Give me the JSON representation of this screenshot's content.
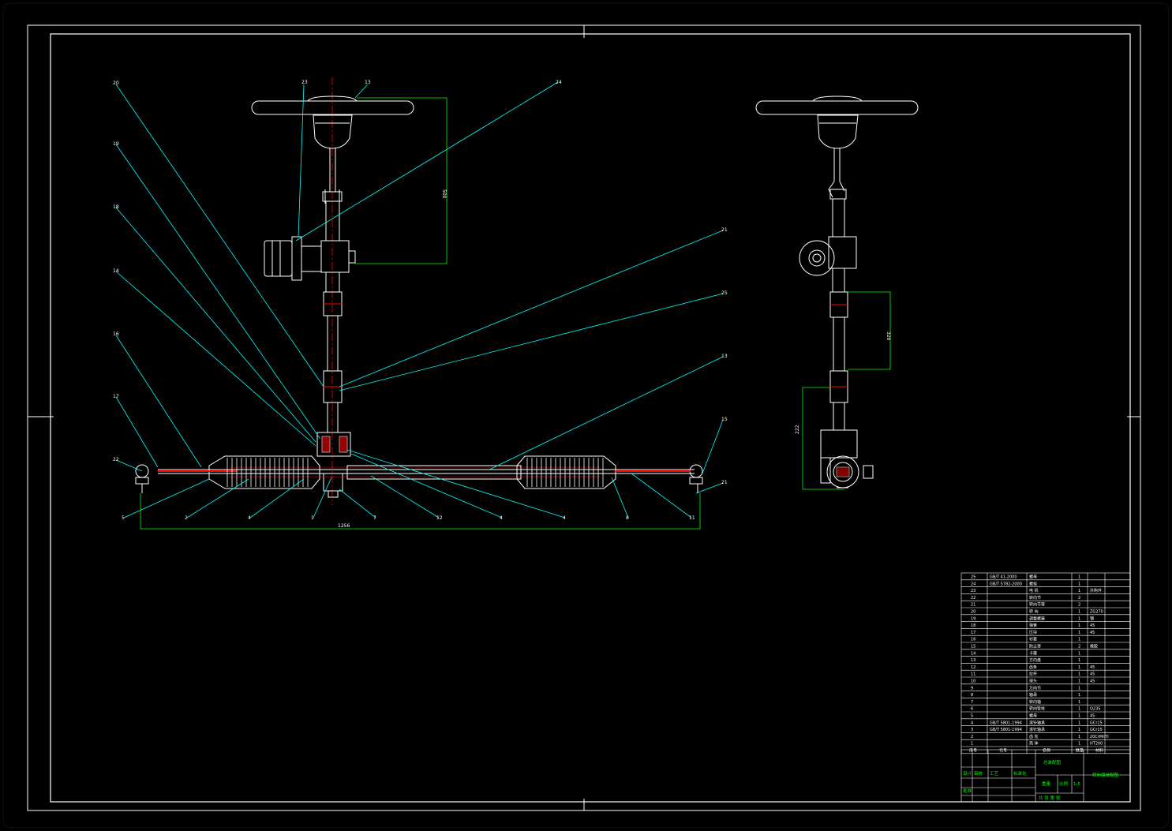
{
  "drawing": {
    "colors": {
      "background": "#000000",
      "outline": "#ffffff",
      "leader": "#00ffff",
      "dimension": "#00ff00",
      "centerline": "#ff0000",
      "section_fill": "#ff0000"
    },
    "callouts_top": [
      "23",
      "13",
      "24"
    ],
    "callouts_left": [
      "20",
      "19",
      "18",
      "14",
      "16",
      "17",
      "22"
    ],
    "callouts_right": [
      "21",
      "25",
      "13",
      "15",
      "21"
    ],
    "callouts_bottom": [
      "5",
      "2",
      "4",
      "1",
      "7",
      "12",
      "4",
      "4",
      "8",
      "11"
    ],
    "dimensions": {
      "column_height": "500",
      "rack_length": "1256",
      "side_shaft": "320",
      "side_lower": "222"
    }
  },
  "bom": {
    "rows": [
      {
        "no": "25",
        "code": "GB/T 41-2000",
        "name": "螺母",
        "qty": "1",
        "material": ""
      },
      {
        "no": "24",
        "code": "GB/T 5782-2000",
        "name": "螺栓",
        "qty": "1",
        "material": ""
      },
      {
        "no": "23",
        "code": "",
        "name": "电 机",
        "qty": "1",
        "material": "外购件"
      },
      {
        "no": "22",
        "code": "",
        "name": "转向节",
        "qty": "2",
        "material": ""
      },
      {
        "no": "21",
        "code": "",
        "name": "转向节臂",
        "qty": "2",
        "material": ""
      },
      {
        "no": "20",
        "code": "",
        "name": "转 向",
        "qty": "1",
        "material": "ZG270"
      },
      {
        "no": "19",
        "code": "",
        "name": "调整螺塞",
        "qty": "1",
        "material": "钢"
      },
      {
        "no": "18",
        "code": "",
        "name": "弹簧",
        "qty": "1",
        "material": "45"
      },
      {
        "no": "17",
        "code": "",
        "name": "压块",
        "qty": "1",
        "material": "45"
      },
      {
        "no": "16",
        "code": "",
        "name": "衬套",
        "qty": "1",
        "material": ""
      },
      {
        "no": "15",
        "code": "",
        "name": "防尘罩",
        "qty": "2",
        "material": "橡胶"
      },
      {
        "no": "14",
        "code": "",
        "name": "卡箍",
        "qty": "1",
        "material": ""
      },
      {
        "no": "13",
        "code": "",
        "name": "方向盘",
        "qty": "1",
        "material": ""
      },
      {
        "no": "12",
        "code": "",
        "name": "齿条",
        "qty": "1",
        "material": "45"
      },
      {
        "no": "11",
        "code": "",
        "name": "拉杆",
        "qty": "1",
        "material": "45"
      },
      {
        "no": "10",
        "code": "",
        "name": "球头",
        "qty": "1",
        "material": "45"
      },
      {
        "no": "9",
        "code": "",
        "name": "万向节",
        "qty": "1",
        "material": ""
      },
      {
        "no": "8",
        "code": "",
        "name": "轴承",
        "qty": "1",
        "material": ""
      },
      {
        "no": "7",
        "code": "",
        "name": "转向轴",
        "qty": "1",
        "material": ""
      },
      {
        "no": "6",
        "code": "",
        "name": "转向管柱",
        "qty": "1",
        "material": "Q235"
      },
      {
        "no": "5",
        "code": "",
        "name": "螺母",
        "qty": "1",
        "material": "45"
      },
      {
        "no": "4",
        "code": "GB/T 5801-1994",
        "name": "滚针轴承",
        "qty": "1",
        "material": "GCr15"
      },
      {
        "no": "3",
        "code": "GB/T 5801-1994",
        "name": "滚针轴承",
        "qty": "1",
        "material": "GCr15"
      },
      {
        "no": "2",
        "code": "",
        "name": "齿 轮",
        "qty": "1",
        "material": "20CrMnTi"
      },
      {
        "no": "1",
        "code": "",
        "name": "壳 体",
        "qty": "1",
        "material": "HT200"
      }
    ],
    "header": [
      "序号",
      "代号",
      "名称",
      "数量",
      "材料"
    ]
  },
  "title_block": {
    "main_title": "总装配图",
    "company": "转向器装配图",
    "labels": {
      "designer": "设计",
      "checker": "审核",
      "process": "工艺",
      "standard": "标准化",
      "approve": "批准",
      "scale_label": "比例",
      "scale": "1:5",
      "sheet": "共 张 第 张",
      "weight": "重量"
    }
  }
}
